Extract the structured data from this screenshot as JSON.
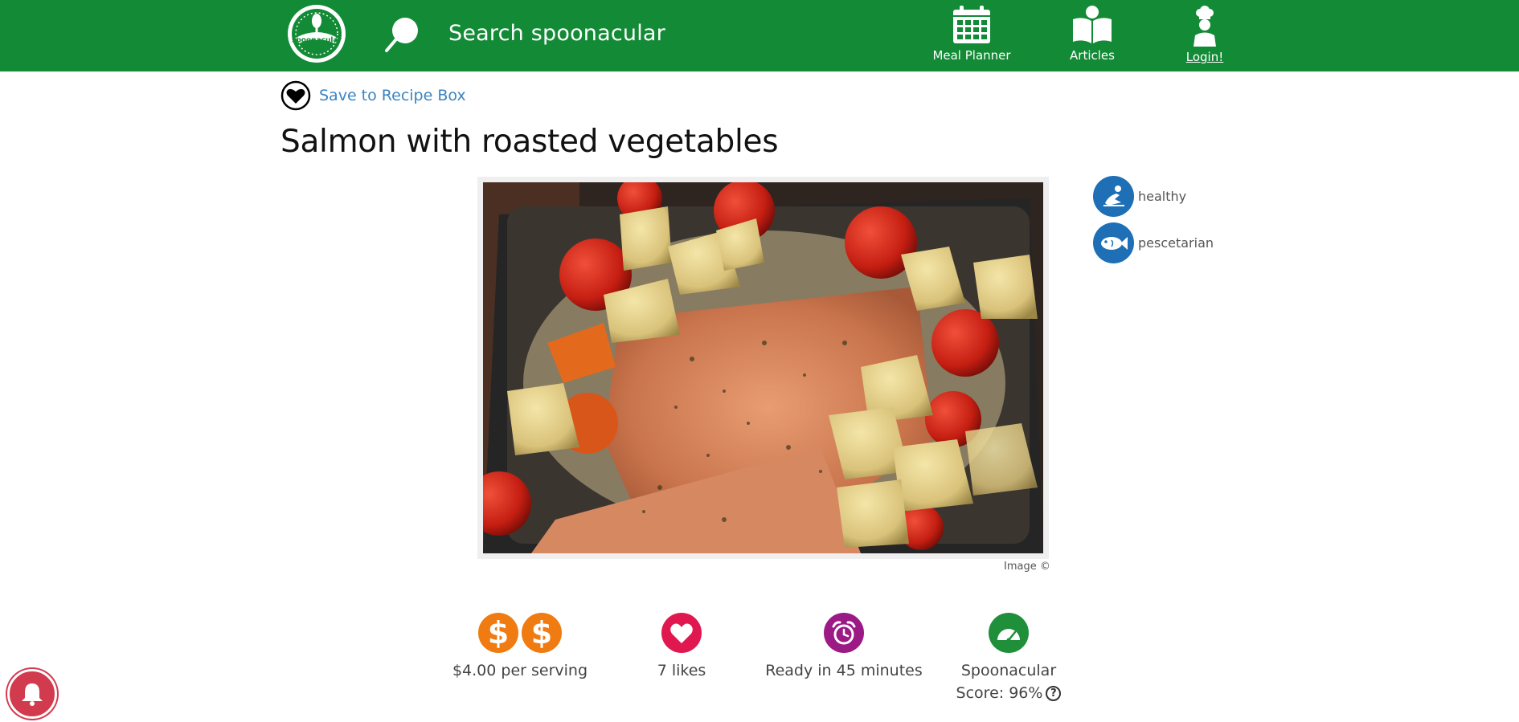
{
  "header": {
    "logo_text": "spoonacular",
    "search_placeholder": "Search spoonacular",
    "nav": {
      "meal_planner": "Meal Planner",
      "articles": "Articles",
      "login": "Login!"
    },
    "brand_color": "#138a36"
  },
  "recipe": {
    "save_label": "Save to Recipe Box",
    "title": "Salmon with roasted vegetables",
    "image_credit": "Image ©",
    "tags": [
      {
        "label": "healthy",
        "icon": "healthy-icon"
      },
      {
        "label": "pescetarian",
        "icon": "fish-icon"
      }
    ],
    "stats": {
      "cost": "$4.00 per serving",
      "likes": "7 likes",
      "ready": "Ready in 45 minutes",
      "score_line1": "Spoonacular",
      "score_line2": "Score: 96%",
      "dollar_sign": "$"
    }
  }
}
